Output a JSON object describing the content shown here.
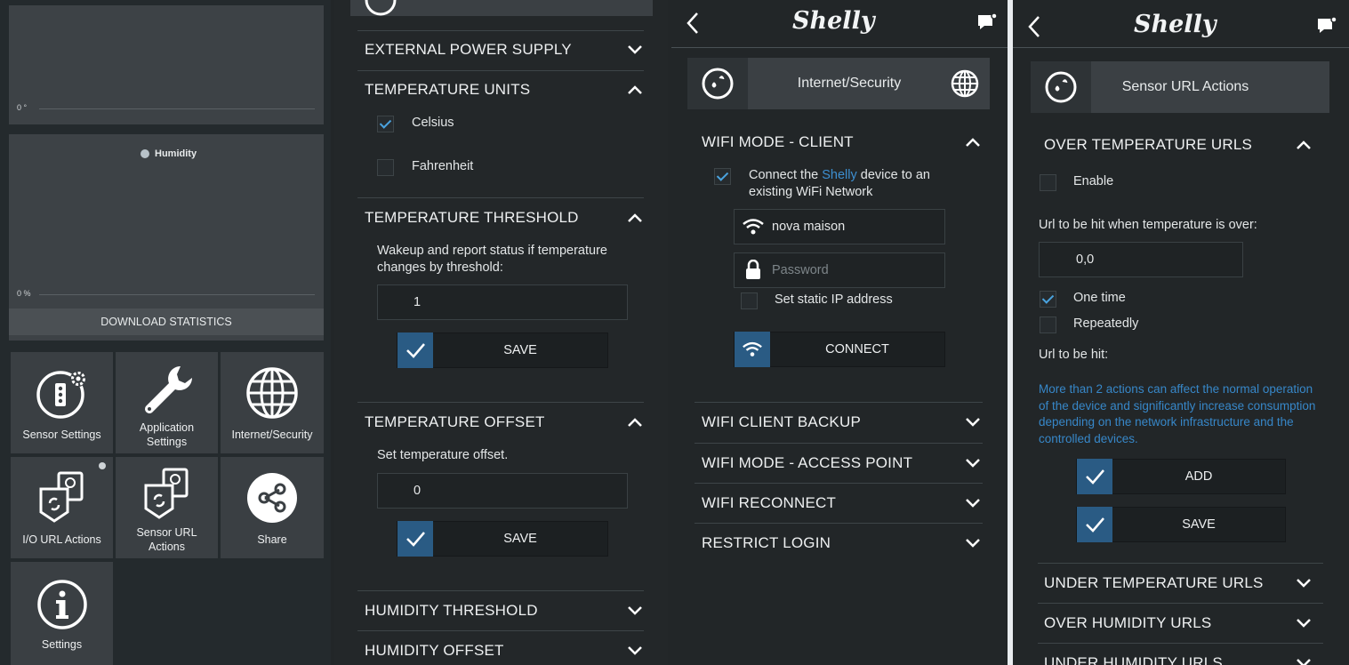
{
  "panel1": {
    "chart_top": {
      "axis_label": "0 °"
    },
    "chart_humidity": {
      "legend": "Humidity",
      "axis_label": "0 %"
    },
    "download_label": "DOWNLOAD STATISTICS",
    "tiles": [
      {
        "label": "Sensor Settings",
        "icon": "sensor-settings-icon"
      },
      {
        "label": "Application Settings",
        "icon": "wrench-icon"
      },
      {
        "label": "Internet/Security",
        "icon": "globe-icon"
      },
      {
        "label": "I/O URL Actions",
        "icon": "url-actions-icon"
      },
      {
        "label": "Sensor URL Actions",
        "icon": "url-actions-icon"
      },
      {
        "label": "Share",
        "icon": "share-icon"
      },
      {
        "label": "Settings",
        "icon": "info-icon"
      }
    ]
  },
  "panel2": {
    "sections": {
      "external_power": "EXTERNAL POWER SUPPLY",
      "temp_units": "TEMPERATURE UNITS",
      "temp_threshold": "TEMPERATURE THRESHOLD",
      "temp_offset": "TEMPERATURE OFFSET",
      "humidity_threshold": "HUMIDITY THRESHOLD",
      "humidity_offset": "HUMIDITY OFFSET"
    },
    "units": {
      "celsius": "Celsius",
      "fahrenheit": "Fahrenheit"
    },
    "threshold_desc": "Wakeup and report status if temperature changes by threshold:",
    "threshold_value": "1",
    "offset_desc": "Set temperature offset.",
    "offset_value": "0",
    "save_label": "SAVE"
  },
  "panel3": {
    "logo": "Shelly",
    "header_title": "Internet/Security",
    "wifi_client_title": "WIFI MODE - CLIENT",
    "connect_text_a": "Connect the ",
    "connect_text_link": "Shelly",
    "connect_text_b": " device to an existing WiFi Network",
    "ssid_value": "nova maison",
    "password_placeholder": "Password",
    "static_ip": "Set static IP address",
    "connect_label": "CONNECT",
    "sections": {
      "backup": "WIFI CLIENT BACKUP",
      "ap": "WIFI MODE - ACCESS POINT",
      "reconnect": "WIFI RECONNECT",
      "restrict": "RESTRICT LOGIN"
    }
  },
  "panel4": {
    "logo": "Shelly",
    "header_title": "Sensor URL Actions",
    "over_temp_title": "OVER TEMPERATURE URLS",
    "enable": "Enable",
    "url_over_label": "Url to be hit when temperature is over:",
    "url_over_value": "0,0",
    "one_time": "One time",
    "repeatedly": "Repeatedly",
    "url_hit_label": "Url to be hit:",
    "warning": "More than 2 actions can affect the normal operation of the device and significantly increase consumption depending on the network infrastructure and the controlled devices.",
    "add_label": "ADD",
    "save_label": "SAVE",
    "sections": {
      "under_temp": "UNDER TEMPERATURE URLS",
      "over_humidity": "OVER HUMIDITY URLS",
      "under_humidity": "UNDER HUMIDITY URLS"
    }
  },
  "colors": {
    "accent": "#4aa3df",
    "button_icon_bg": "#2a5b84",
    "panel_bg": "#222628",
    "tile_bg": "#3a3f43"
  }
}
